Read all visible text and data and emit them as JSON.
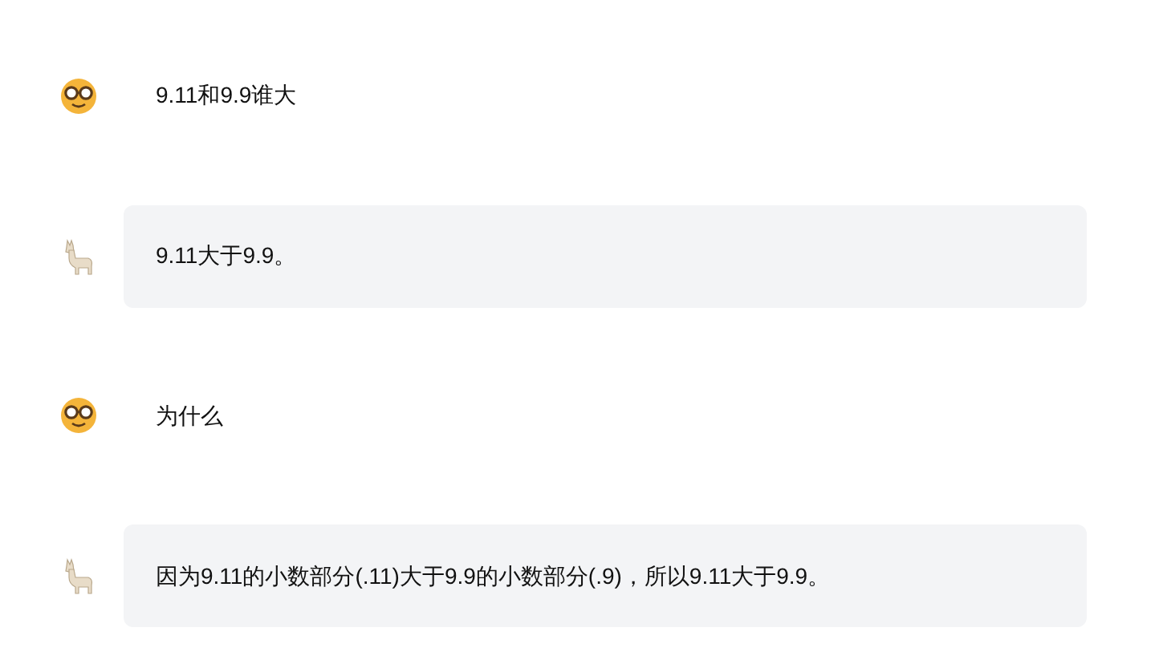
{
  "messages": [
    {
      "kind": "user",
      "text": "9.11和9.9谁大"
    },
    {
      "kind": "assistant",
      "text": "9.11大于9.9。"
    },
    {
      "kind": "user",
      "text": "为什么"
    },
    {
      "kind": "assistant",
      "text": "因为9.11的小数部分(.11)大于9.9的小数部分(.9)，所以9.11大于9.9。"
    }
  ]
}
